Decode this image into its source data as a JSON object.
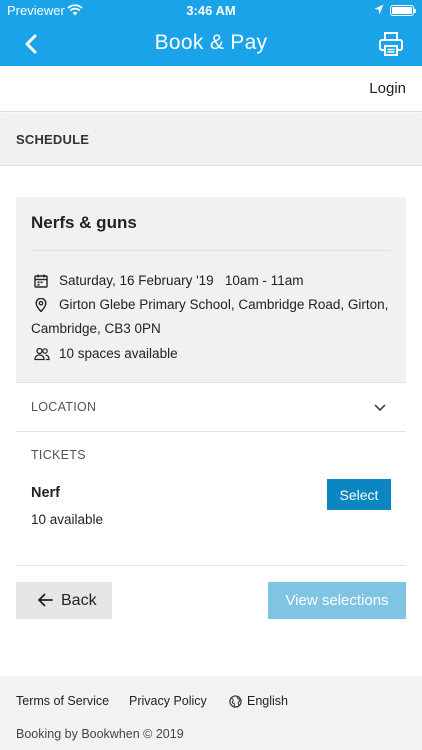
{
  "status_bar": {
    "carrier": "Previewer",
    "time": "3:46 AM"
  },
  "nav": {
    "title": "Book & Pay",
    "back_icon": "chevron-left-icon",
    "print_icon": "printer-icon"
  },
  "login_bar": {
    "login_label": "Login"
  },
  "schedule": {
    "section_label": "SCHEDULE"
  },
  "event": {
    "title": "Nerfs & guns",
    "date_time": "Saturday, 16 February '19   10am - 11am",
    "address_line1": "Girton Glebe Primary School, Cambridge Road, Girton,",
    "address_line2": "Cambridge, CB3 0PN",
    "spaces": "10 spaces available"
  },
  "location": {
    "label": "LOCATION"
  },
  "tickets": {
    "label": "TICKETS",
    "items": [
      {
        "name": "Nerf",
        "availability": "10 available",
        "select_label": "Select"
      }
    ]
  },
  "actions": {
    "back_label": "Back",
    "view_selections_label": "View selections"
  },
  "footer": {
    "terms_label": "Terms of Service",
    "privacy_label": "Privacy Policy",
    "language_label": "English",
    "credit": "Booking by Bookwhen © 2019"
  },
  "colors": {
    "brand_blue": "#1aa3e8",
    "select_button": "#0c86c0",
    "view_selections_button": "#7fc5e3"
  }
}
